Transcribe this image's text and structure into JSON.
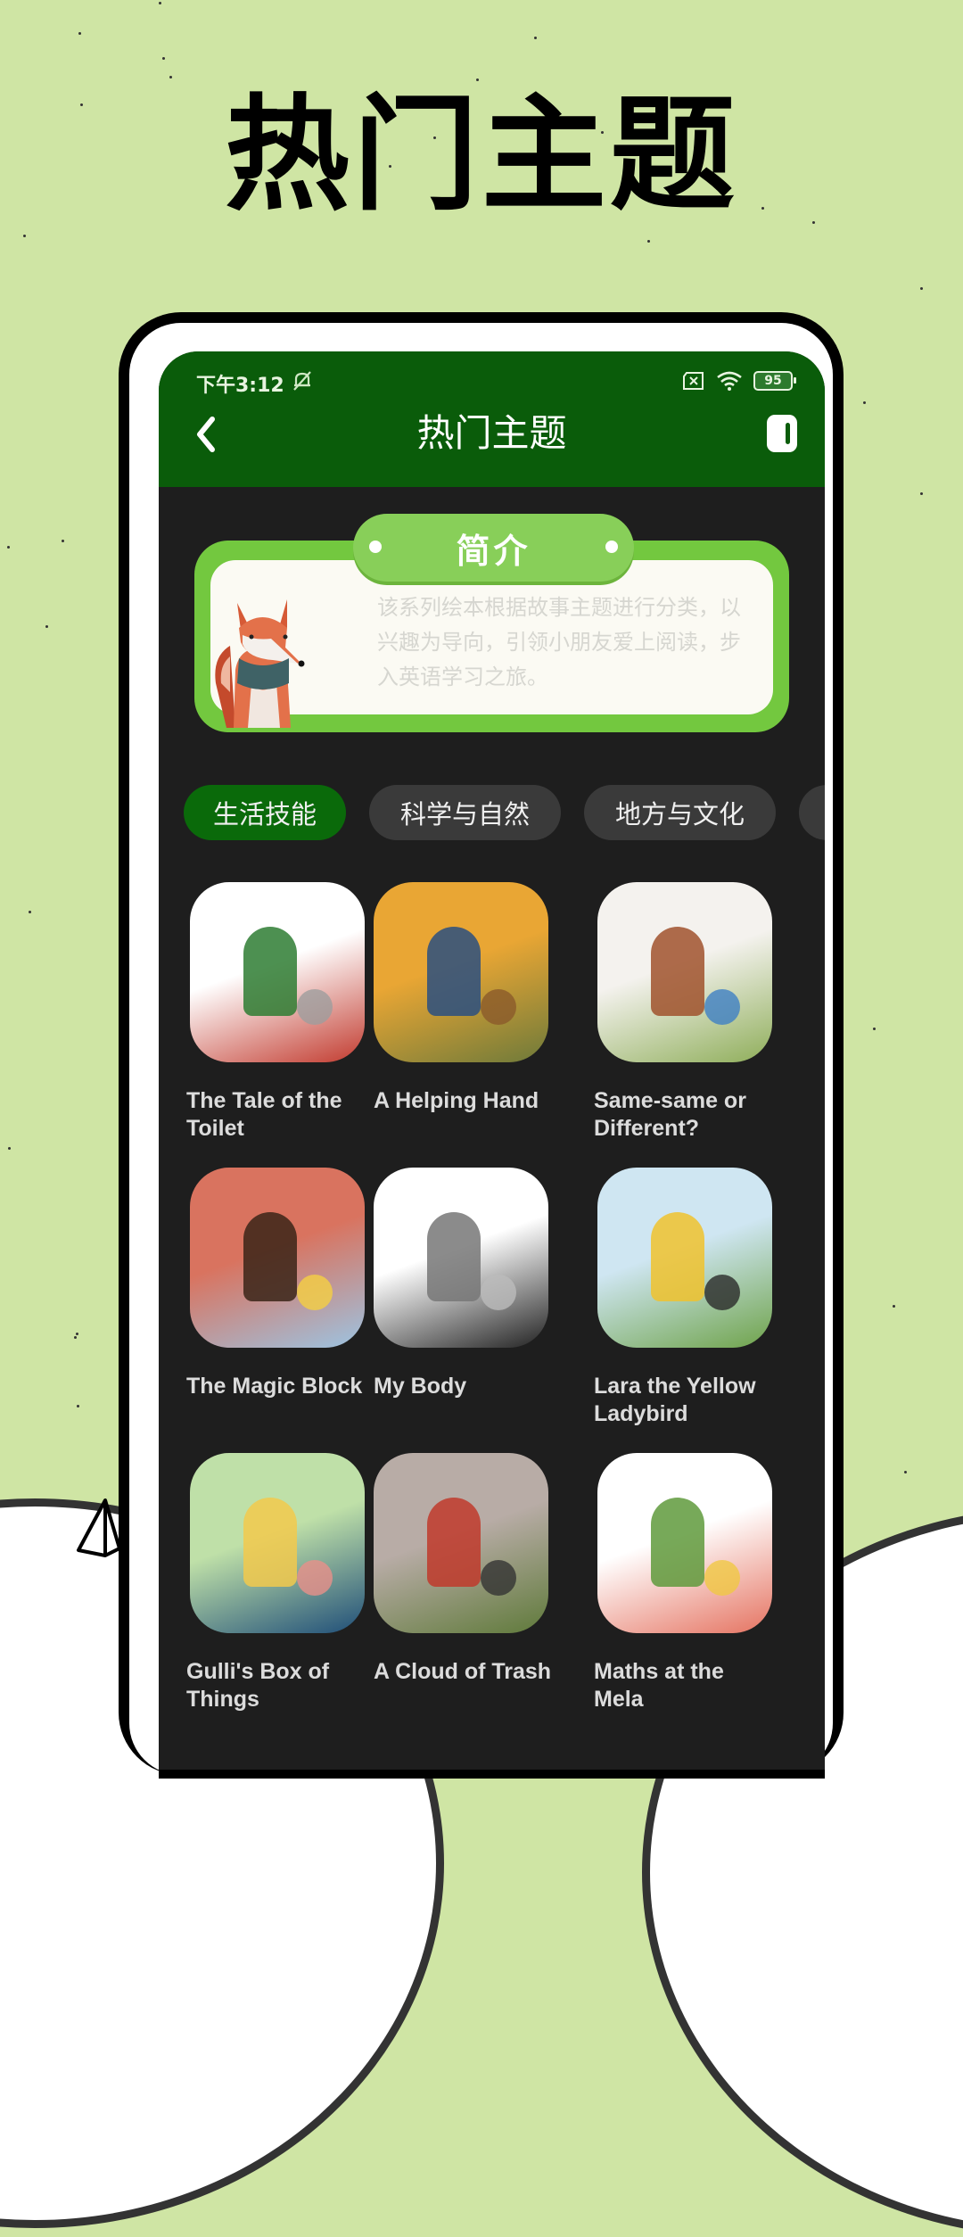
{
  "promo": {
    "headline": "热门主题"
  },
  "status_bar": {
    "time": "下午3:12",
    "battery_level": "95",
    "icons": [
      "bell-off-icon",
      "sim-x-icon",
      "wifi-icon",
      "battery-icon"
    ]
  },
  "nav": {
    "title": "热门主题",
    "back_icon": "chevron-left-icon",
    "right_icon": "toggle-icon"
  },
  "intro": {
    "title": "简介",
    "text": "该系列绘本根据故事主题进行分类，以兴趣为导向，引领小朋友爱上阅读，步入英语学习之旅。"
  },
  "categories": [
    {
      "label": "生活技能",
      "active": true
    },
    {
      "label": "科学与自然",
      "active": false
    },
    {
      "label": "地方与文化",
      "active": false
    },
    {
      "label": "…",
      "active": false
    }
  ],
  "books": [
    {
      "title": "The Tale of the Toilet",
      "cover_colors": [
        "#ffffff",
        "#c23b2f",
        "#2e7d32",
        "#9e9e9e"
      ]
    },
    {
      "title": "A Helping Hand",
      "cover_colors": [
        "#e9a634",
        "#6e7a3a",
        "#2a4f80",
        "#8b5a2b"
      ]
    },
    {
      "title": "Same-same or Different?",
      "cover_colors": [
        "#f4f2ee",
        "#8fae5a",
        "#a0522d",
        "#3f7fc4"
      ]
    },
    {
      "title": "The Magic Block",
      "cover_colors": [
        "#d9735f",
        "#9cc4e2",
        "#3a2418",
        "#f5d042"
      ]
    },
    {
      "title": "My Body",
      "cover_colors": [
        "#ffffff",
        "#222222",
        "#777777",
        "#bbbbbb"
      ]
    },
    {
      "title": "Lara the Yellow Ladybird",
      "cover_colors": [
        "#cfe6f2",
        "#6fa34a",
        "#f0c22e",
        "#2a2a2a"
      ]
    },
    {
      "title": "Gulli's Box of Things",
      "cover_colors": [
        "#bfe0a8",
        "#1f4e79",
        "#f2c94c",
        "#e8908a"
      ]
    },
    {
      "title": "A Cloud of Trash",
      "cover_colors": [
        "#b8aca6",
        "#5f7a3a",
        "#c0392b",
        "#333333"
      ]
    },
    {
      "title": "Maths at the Mela",
      "cover_colors": [
        "#ffffff",
        "#e57361",
        "#5f9a3c",
        "#f0c843"
      ]
    }
  ],
  "colors": {
    "background": "#cfe5a4",
    "header": "#0a5c0a",
    "active_chip": "#0a6a0a",
    "chip": "#3a3a3a",
    "screen_bg": "#1e1e1e",
    "intro_green": "#73c83f"
  }
}
